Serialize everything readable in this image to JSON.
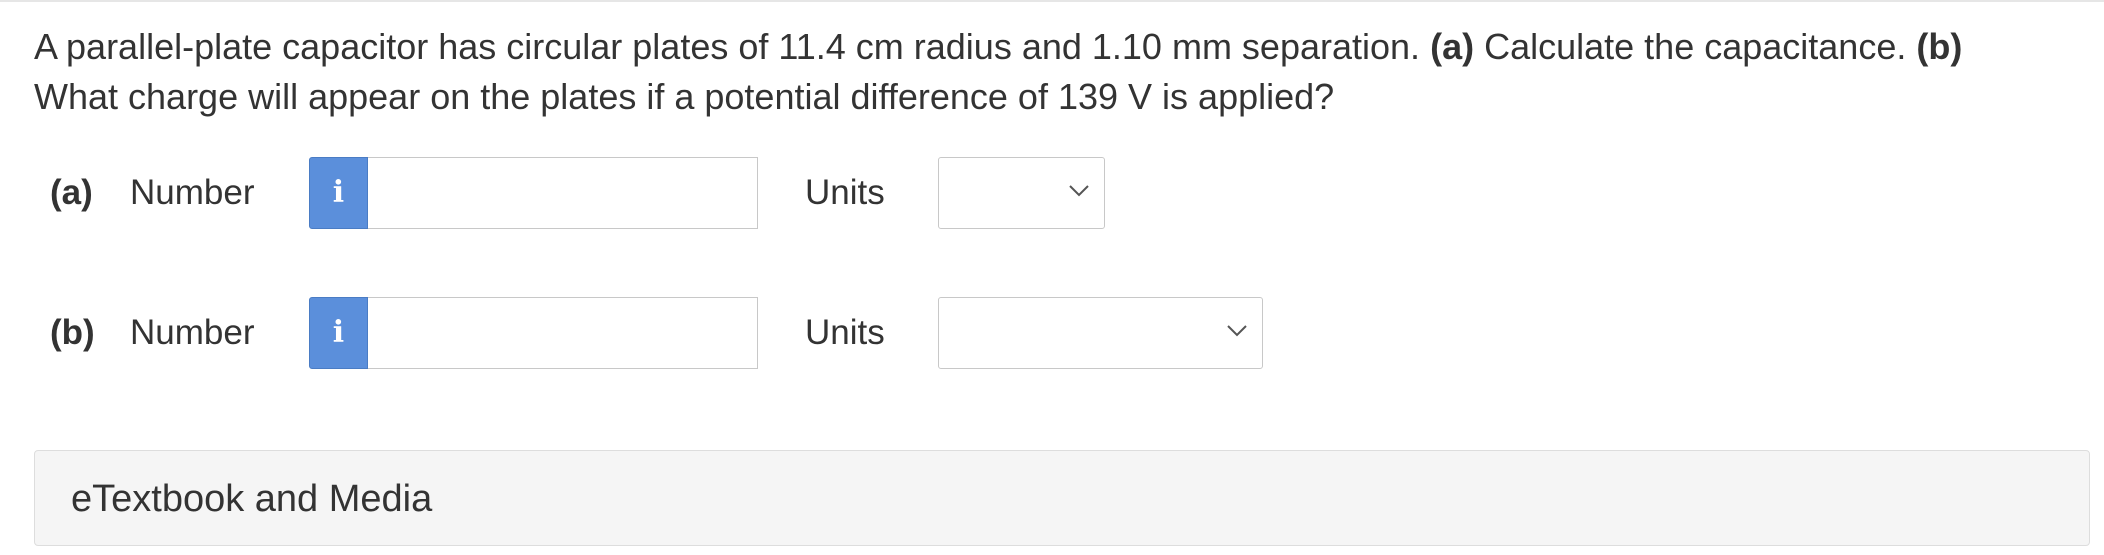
{
  "question": {
    "intro": "A parallel-plate capacitor has circular plates of 11.4 cm radius and 1.10 mm separation.",
    "part_a_marker": "(a)",
    "part_a_text": "Calculate the capacitance.",
    "part_b_marker": "(b)",
    "part_b_text": "What charge will appear on the plates if a potential difference of 139 V is applied?"
  },
  "answers": [
    {
      "part": "(a)",
      "number_label": "Number",
      "info_icon": "i",
      "number_value": "",
      "units_label": "Units",
      "units_selected": ""
    },
    {
      "part": "(b)",
      "number_label": "Number",
      "info_icon": "i",
      "number_value": "",
      "units_label": "Units",
      "units_selected": ""
    }
  ],
  "etextbook": {
    "title": "eTextbook and Media"
  },
  "colors": {
    "info_button": "#5b8fdb",
    "text": "#333333",
    "panel_bg": "#f5f5f5"
  }
}
